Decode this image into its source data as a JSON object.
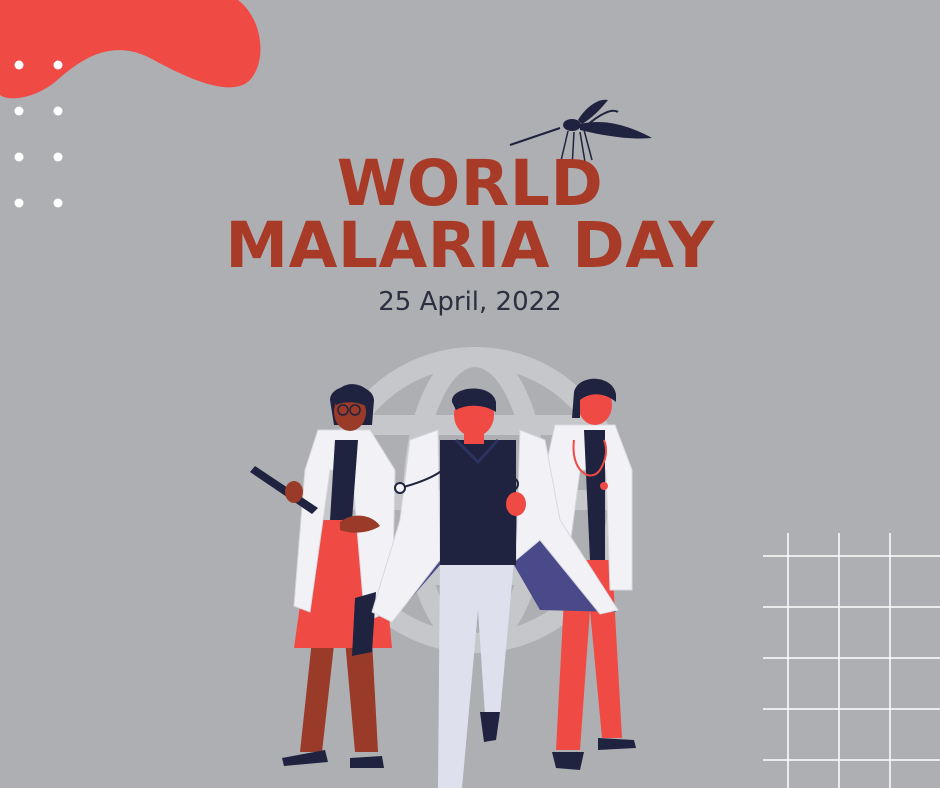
{
  "poster": {
    "title_line1": "WORLD",
    "title_line2": "MALARIA DAY",
    "date": "25 April, 2022"
  },
  "colors": {
    "background": "#aeafb2",
    "title": "#a83a28",
    "date_text": "#2c2f40",
    "accent_red": "#f04a44",
    "navy": "#1f2340",
    "coat_white": "#f2f2f6",
    "coat_lining": "#4a4a8a",
    "globe": "#c6c7ca"
  },
  "icons": [
    "red-blob-decoration",
    "dot-grid-decoration",
    "mosquito-icon",
    "globe-icon",
    "line-grid-decoration"
  ]
}
